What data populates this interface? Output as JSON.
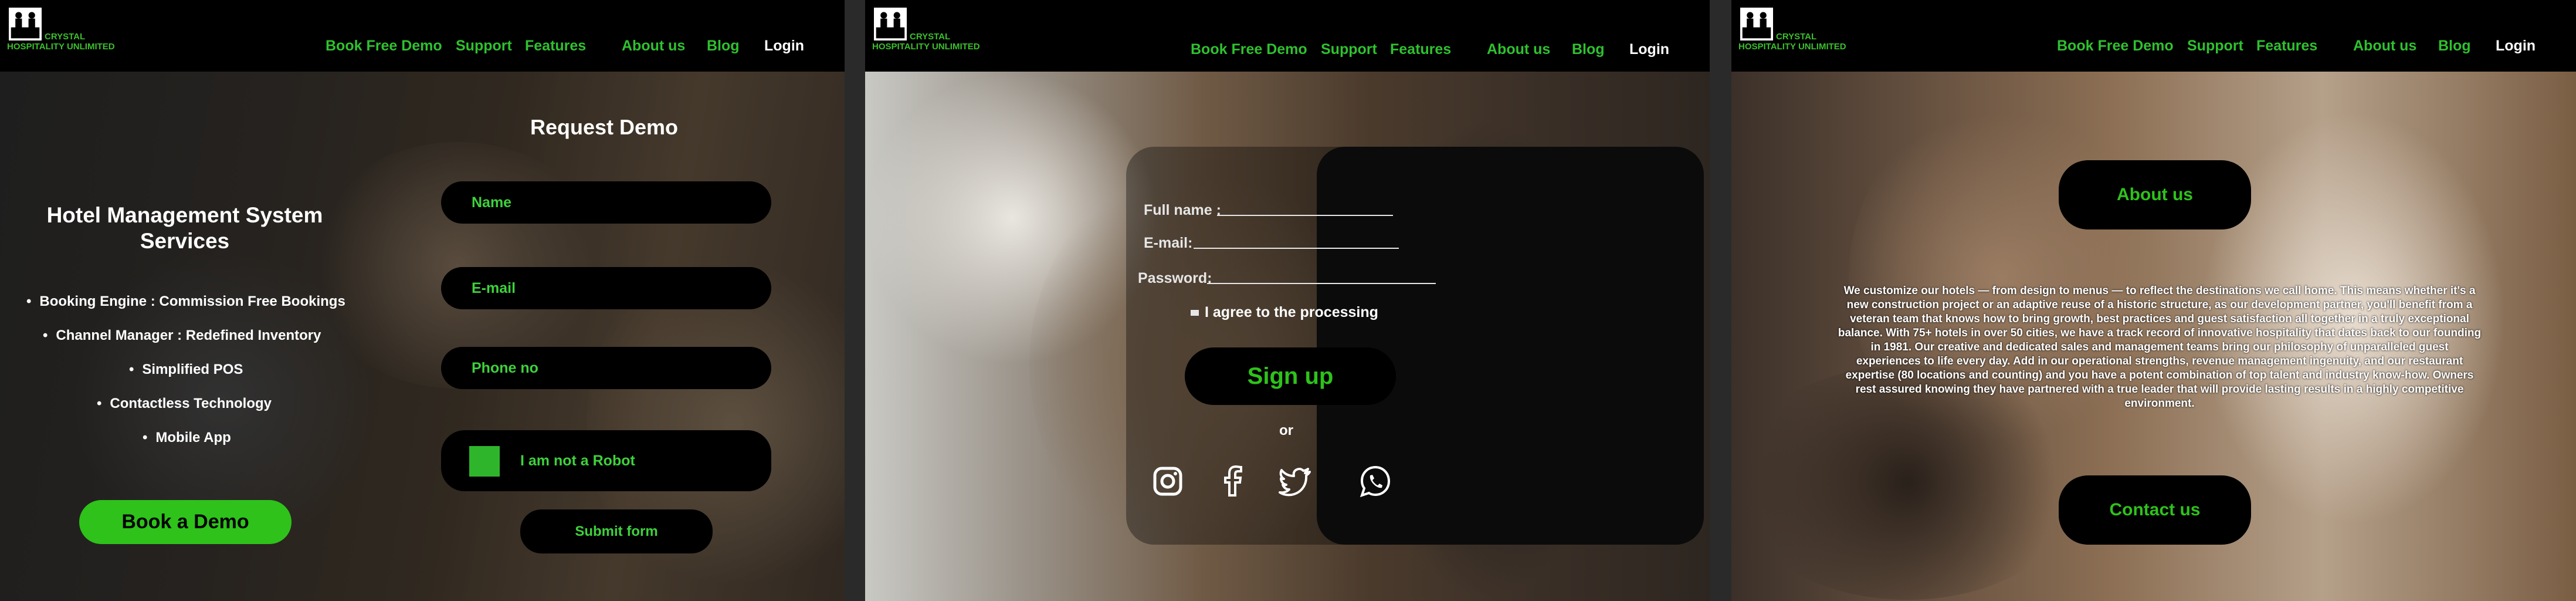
{
  "brand": {
    "line1": "CRYSTAL",
    "line2": "HOSPITALITY UNLIMITED"
  },
  "nav": {
    "book_demo": "Book Free Demo",
    "support": "Support",
    "features": "Features",
    "about": "About us",
    "blog": "Blog",
    "login": "Login"
  },
  "colors": {
    "accent": "#2ec21b",
    "nav_bg": "#000000",
    "text": "#ffffff"
  },
  "panel1": {
    "title": "Hotel Management System Services",
    "bullets": [
      "Booking Engine : Commission Free Bookings",
      "Channel Manager : Redefined Inventory",
      "Simplified POS",
      "Contactless Technology",
      "Mobile App"
    ],
    "cta": "Book a Demo",
    "form_title": "Request Demo",
    "name_placeholder": "Name",
    "email_placeholder": "E-mail",
    "phone_placeholder": "Phone no",
    "robot_label": "I am not a Robot",
    "submit": "Submit form"
  },
  "panel2": {
    "full_name_label": "Full name :",
    "email_label": "E-mail:",
    "password_label": "Password:",
    "agree": "I agree to the processing",
    "signup": "Sign up",
    "or": "or",
    "social": [
      "instagram-icon",
      "facebook-icon",
      "twitter-icon",
      "whatsapp-icon"
    ]
  },
  "panel3": {
    "about": "About us",
    "contact": "Contact us",
    "paragraph": "We customize our hotels — from design to menus — to reflect the destinations we call home. This means whether it's a new construction project or an adaptive reuse of a historic structure, as our development partner, you'll benefit from a veteran team that knows how to bring growth, best practices and guest satisfaction all together in a truly exceptional balance. With 75+ hotels in over 50 cities, we have a track record of innovative hospitality that dates back to our founding in 1981. Our creative and dedicated sales and management teams bring our philosophy of unparalleled guest experiences to life every day. Add in our operational strengths, revenue management ingenuity, and our restaurant expertise (80 locations and counting) and you have a potent combination of top talent and industry know-how. Owners rest assured knowing they have partnered with a true leader that will provide lasting results in a highly competitive environment."
  }
}
